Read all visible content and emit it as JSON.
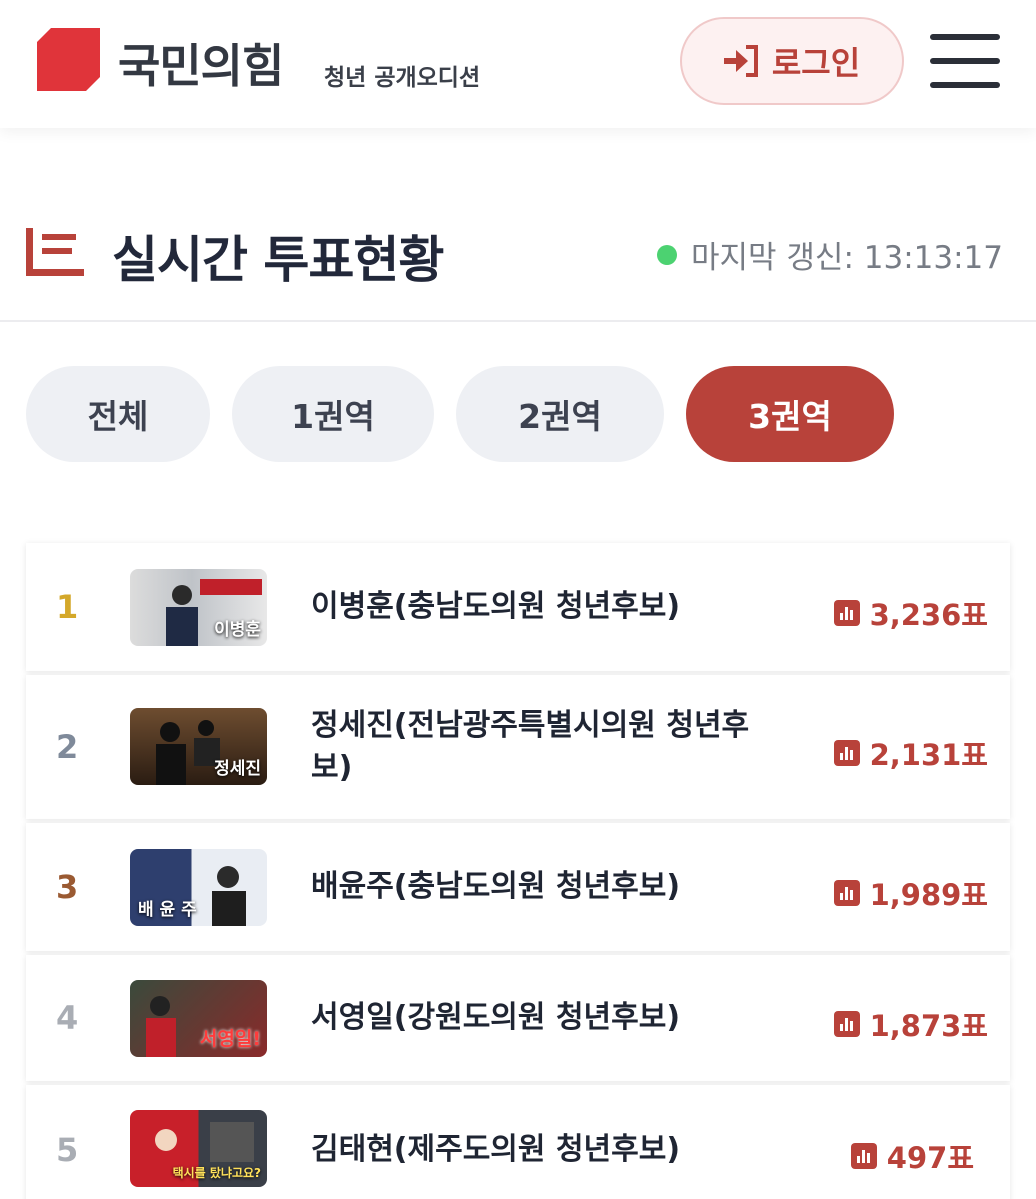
{
  "header": {
    "brand": "국민의힘",
    "brand_sub": "청년 공개오디션",
    "login_label": "로그인"
  },
  "section": {
    "title": "실시간 투표현황",
    "last_update": "마지막 갱신: 13:13:17"
  },
  "tabs": [
    {
      "label": "전체",
      "active": false
    },
    {
      "label": "1권역",
      "active": false
    },
    {
      "label": "2권역",
      "active": false
    },
    {
      "label": "3권역",
      "active": true
    }
  ],
  "candidates": [
    {
      "rank": "1",
      "name": "이병훈(충남도의원 청년후보)",
      "votes": "3,236표",
      "thumb_caption": "이병훈"
    },
    {
      "rank": "2",
      "name": "정세진(전남광주특별시의원 청년후보)",
      "votes": "2,131표",
      "thumb_caption": "정세진"
    },
    {
      "rank": "3",
      "name": "배윤주(충남도의원 청년후보)",
      "votes": "1,989표",
      "thumb_caption": "배 윤 주"
    },
    {
      "rank": "4",
      "name": "서영일(강원도의원 청년후보)",
      "votes": "1,873표",
      "thumb_caption": "서영일!"
    },
    {
      "rank": "5",
      "name": "김태현(제주도의원 청년후보)",
      "votes": "497표",
      "thumb_caption": "택시를 탔냐고요?"
    }
  ],
  "colors": {
    "accent": "#b8423a",
    "rank_gold": "#d4a82a",
    "rank_silver": "#7f8a9a",
    "rank_bronze": "#9a5a32",
    "rank_default": "#a9adb4",
    "status_dot": "#4cd271"
  },
  "icons": {
    "logo": "party-logo-icon",
    "login": "login-arrow-icon",
    "menu": "hamburger-menu-icon",
    "title": "list-chart-icon",
    "votes": "bar-chart-icon"
  }
}
